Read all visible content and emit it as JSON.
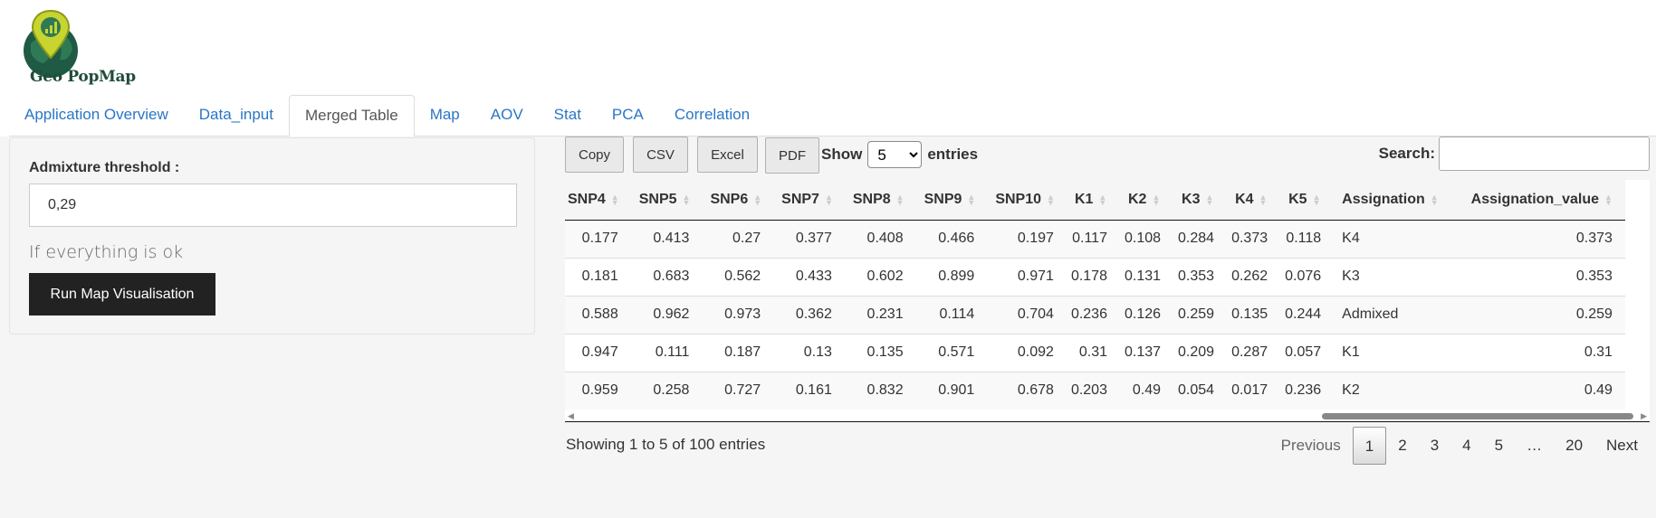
{
  "brand": {
    "logo_text": "Geo PopMap",
    "colors": {
      "primary": "#1f4d3a",
      "accent": "#8bc34a",
      "pin": "#c8d42f"
    }
  },
  "tabs": [
    {
      "label": "Application Overview",
      "active": false
    },
    {
      "label": "Data_input",
      "active": false
    },
    {
      "label": "Merged Table",
      "active": true
    },
    {
      "label": "Map",
      "active": false
    },
    {
      "label": "AOV",
      "active": false
    },
    {
      "label": "Stat",
      "active": false
    },
    {
      "label": "PCA",
      "active": false
    },
    {
      "label": "Correlation",
      "active": false
    }
  ],
  "sidebar": {
    "threshold_label": "Admixture threshold :",
    "threshold_value": "0,29",
    "note": "If everything is ok",
    "run_button": "Run Map Visualisation"
  },
  "toolbar": {
    "copy": "Copy",
    "csv": "CSV",
    "excel": "Excel",
    "pdf": "PDF",
    "show_label": "Show",
    "show_value": "5",
    "entries_label": "entries",
    "search_label": "Search:"
  },
  "table": {
    "columns": [
      "SNP4",
      "SNP5",
      "SNP6",
      "SNP7",
      "SNP8",
      "SNP9",
      "SNP10",
      "K1",
      "K2",
      "K3",
      "K4",
      "K5",
      "Assignation",
      "Assignation_value"
    ],
    "rows": [
      [
        "0.177",
        "0.413",
        "0.27",
        "0.377",
        "0.408",
        "0.466",
        "0.197",
        "0.117",
        "0.108",
        "0.284",
        "0.373",
        "0.118",
        "K4",
        "0.373"
      ],
      [
        "0.181",
        "0.683",
        "0.562",
        "0.433",
        "0.602",
        "0.899",
        "0.971",
        "0.178",
        "0.131",
        "0.353",
        "0.262",
        "0.076",
        "K3",
        "0.353"
      ],
      [
        "0.588",
        "0.962",
        "0.973",
        "0.362",
        "0.231",
        "0.114",
        "0.704",
        "0.236",
        "0.126",
        "0.259",
        "0.135",
        "0.244",
        "Admixed",
        "0.259"
      ],
      [
        "0.947",
        "0.111",
        "0.187",
        "0.13",
        "0.135",
        "0.571",
        "0.092",
        "0.31",
        "0.137",
        "0.209",
        "0.287",
        "0.057",
        "K1",
        "0.31"
      ],
      [
        "0.959",
        "0.258",
        "0.727",
        "0.161",
        "0.832",
        "0.901",
        "0.678",
        "0.203",
        "0.49",
        "0.054",
        "0.017",
        "0.236",
        "K2",
        "0.49"
      ]
    ]
  },
  "footer": {
    "info": "Showing 1 to 5 of 100 entries",
    "previous": "Previous",
    "pages": [
      "1",
      "2",
      "3",
      "4",
      "5",
      "…",
      "20"
    ],
    "current_page": "1",
    "next": "Next"
  }
}
